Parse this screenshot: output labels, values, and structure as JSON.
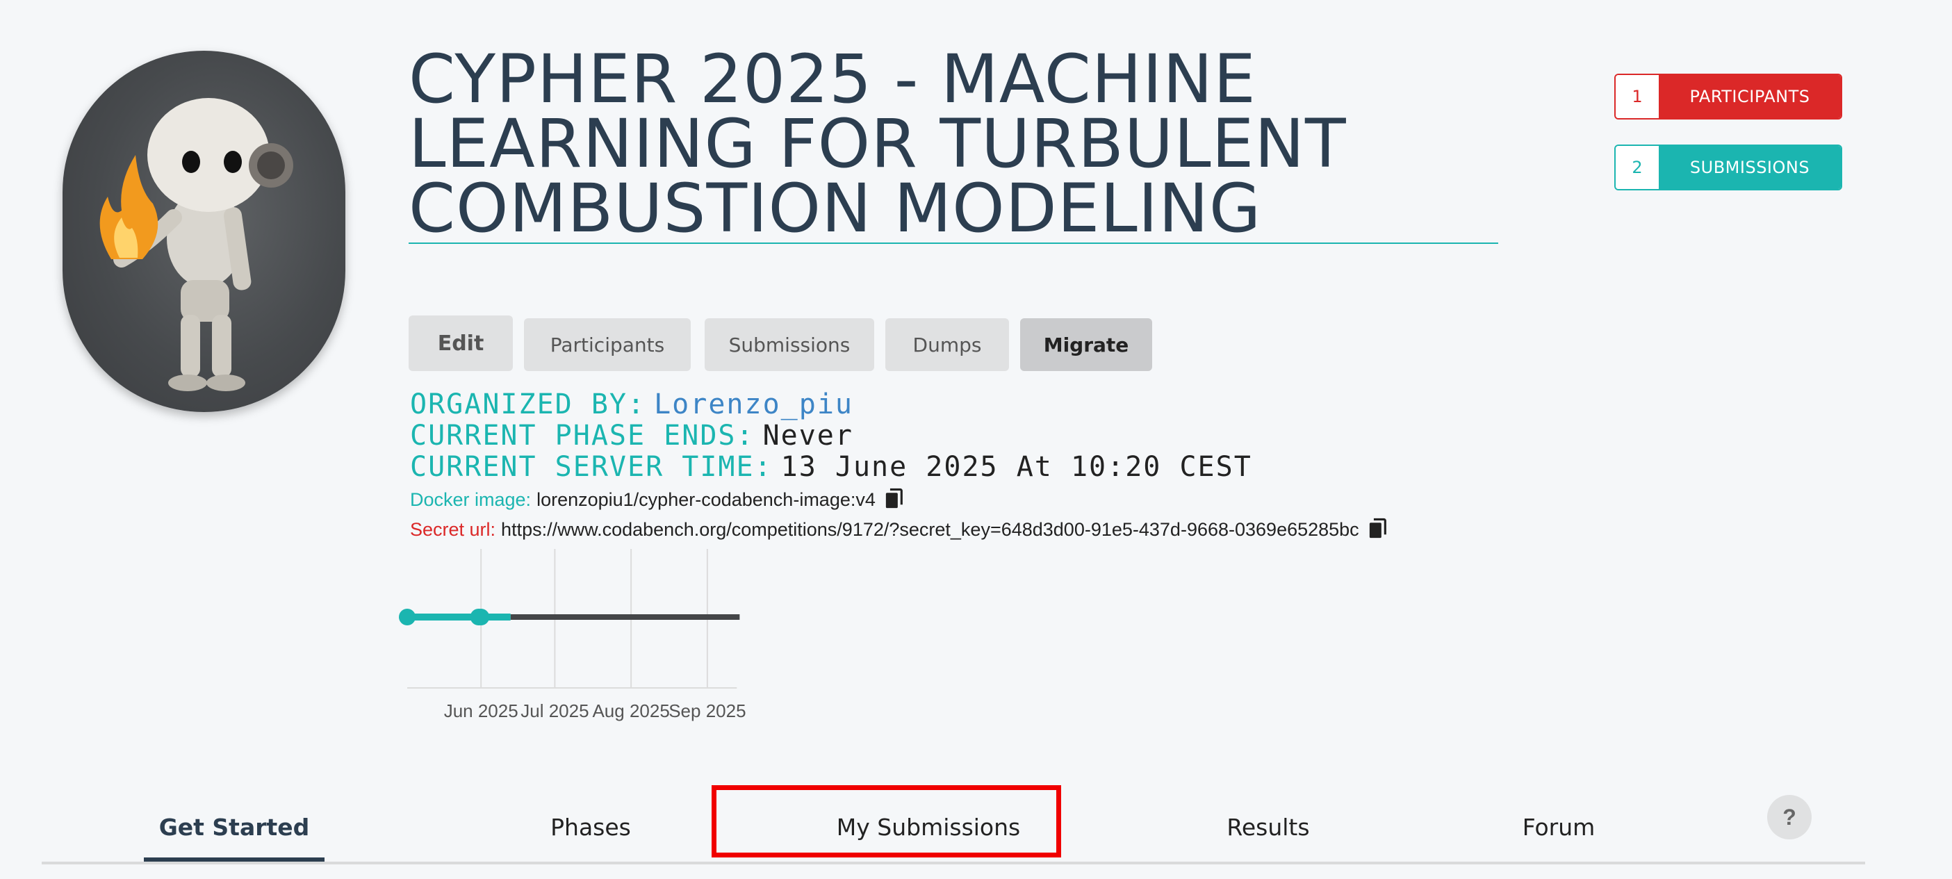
{
  "competition": {
    "title": "CYPHER 2025 - MACHINE LEARNING FOR TURBULENT COMBUSTION MODELING",
    "logo_icon": "robot-holding-flame-icon"
  },
  "stats": {
    "participants_count": "1",
    "participants_label": "PARTICIPANTS",
    "submissions_count": "2",
    "submissions_label": "SUBMISSIONS"
  },
  "admin_buttons": {
    "edit": "Edit",
    "participants": "Participants",
    "submissions": "Submissions",
    "dumps": "Dumps",
    "migrate": "Migrate"
  },
  "info": {
    "organized_by_label": "ORGANIZED BY:",
    "organized_by_value": "Lorenzo_piu",
    "phase_ends_label": "CURRENT PHASE ENDS:",
    "phase_ends_value": "Never",
    "server_time_label": "CURRENT SERVER TIME:",
    "server_time_value": "13 June 2025 At 10:20 CEST",
    "docker_label": "Docker image:",
    "docker_value": "lorenzopiu1/cypher-codabench-image:v4",
    "secret_label": "Secret url:",
    "secret_value": "https://www.codabench.org/competitions/9172/?secret_key=648d3d00-91e5-437d-9668-0369e65285bc"
  },
  "timeline": {
    "axis_labels": [
      "Jun 2025",
      "Jul 2025",
      "Aug 2025",
      "Sep 2025"
    ],
    "axis_dates": [
      "2025-06-01",
      "2025-07-01",
      "2025-08-01",
      "2025-09-01"
    ],
    "start_date": "2025-05-02",
    "end_date": "2025-09-13",
    "current_date": "2025-06-13",
    "phase_markers": [
      "2025-05-02",
      "2025-05-31",
      "2025-06-01"
    ],
    "completed_color": "#1bb5b0",
    "remaining_color": "#444648"
  },
  "tabs": [
    {
      "label": "Get Started",
      "active": true
    },
    {
      "label": "Phases"
    },
    {
      "label": "My Submissions"
    },
    {
      "label": "Results"
    },
    {
      "label": "Forum"
    }
  ],
  "help_label": "?",
  "colors": {
    "accent": "#1bb5b0",
    "danger": "#db2828",
    "title": "#2c3e50",
    "highlight": "#f00000"
  }
}
